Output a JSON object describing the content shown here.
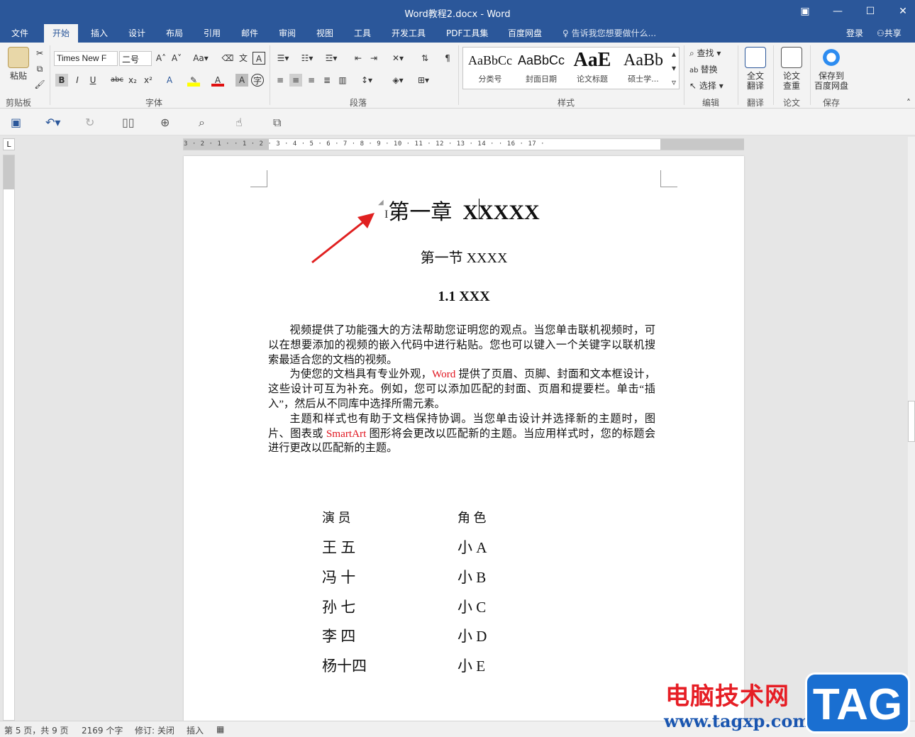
{
  "window": {
    "title": "Word教程2.docx - Word"
  },
  "menu": {
    "tabs": [
      "文件",
      "开始",
      "插入",
      "设计",
      "布局",
      "引用",
      "邮件",
      "审阅",
      "视图",
      "工具",
      "开发工具",
      "PDF工具集",
      "百度网盘"
    ],
    "tell_me": "告诉我您想要做什么...",
    "login": "登录",
    "share": "共享"
  },
  "ribbon": {
    "clipboard": {
      "paste": "粘贴",
      "label": "剪贴板"
    },
    "font": {
      "name": "Times New F",
      "size": "二号",
      "label": "字体"
    },
    "paragraph": {
      "label": "段落"
    },
    "styles": {
      "label": "样式",
      "items": [
        {
          "preview": "AaBbCc",
          "name": "分类号"
        },
        {
          "preview": "AaBbCc",
          "name": "封面日期"
        },
        {
          "preview": "AaE",
          "name": "论文标题"
        },
        {
          "preview": "AaBb",
          "name": "硕士学..."
        }
      ]
    },
    "editing": {
      "find": "查找",
      "replace": "替换",
      "select": "选择",
      "label": "编辑"
    },
    "translate": {
      "btn_line1": "全文",
      "btn_line2": "翻译",
      "label": "翻译"
    },
    "paper": {
      "btn_line1": "论文",
      "btn_line2": "查重",
      "label": "论文"
    },
    "save": {
      "btn_line1": "保存到",
      "btn_line2": "百度网盘",
      "label": "保存"
    }
  },
  "ruler": {
    "numbers": "3 · 2 · 1 · · 1 · 2 · 3 · 4 · 5 · 6 · 7 · 8 · 9 · 10 · 11 · 12 · 13 · 14 · · 16 · 17 ·"
  },
  "document": {
    "chapter_cn": "第一章",
    "chapter_latin": "XXXXX",
    "section": "第一节  XXXX",
    "subsection": "1.1 XXX",
    "para1": "视频提供了功能强大的方法帮助您证明您的观点。当您单击联机视频时，可以在想要添加的视频的嵌入代码中进行粘贴。您也可以键入一个关键字以联机搜索最适合您的文档的视频。",
    "para2_a": "为使您的文档具有专业外观，",
    "para2_word": "Word",
    "para2_b": " 提供了页眉、页脚、封面和文本框设计，这些设计可互为补充。例如，您可以添加匹配的封面、页眉和提要栏。单击“插入”，然后从不同库中选择所需元素。",
    "para3_a": "主题和样式也有助于文档保持协调。当您单击设计并选择新的主题时，图片、图表或 ",
    "para3_smartart": "SmartArt",
    "para3_b": " 图形将会更改以匹配新的主题。当应用样式时，您的标题会进行更改以匹配新的主题。",
    "cast_header": {
      "actor": "演    员",
      "role": "角  色"
    },
    "cast": [
      {
        "actor": "王   五",
        "role": "小  A"
      },
      {
        "actor": "冯   十",
        "role": "小  B"
      },
      {
        "actor": "孙   七",
        "role": "小  C"
      },
      {
        "actor": "李   四",
        "role": "小  D"
      },
      {
        "actor": "杨十四",
        "role": "小  E"
      }
    ]
  },
  "status": {
    "page": "第 5 页，共 9 页",
    "words": "2169 个字",
    "revision": "修订: 关闭",
    "mode": "插入"
  },
  "watermark": {
    "site_name": "电脑技术网",
    "url": "www.tagxp.com",
    "tag": "TAG"
  },
  "colors": {
    "accent": "#2b579a",
    "red_text": "#e0141e",
    "arrow": "#e02020"
  }
}
